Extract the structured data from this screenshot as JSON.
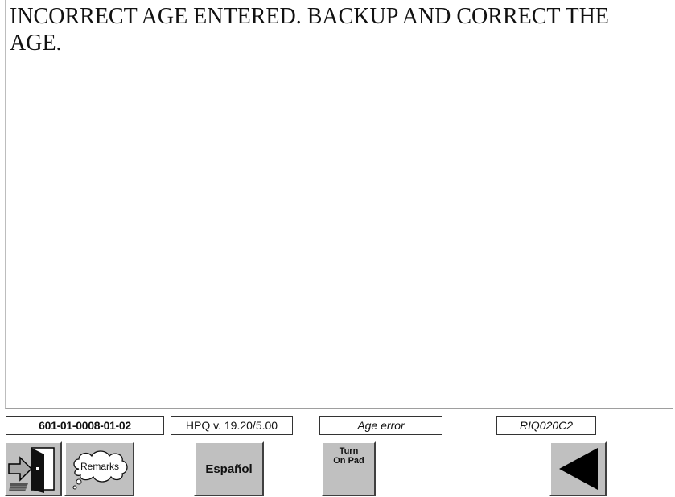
{
  "question": {
    "text": "INCORRECT AGE ENTERED. BACKUP AND CORRECT THE AGE."
  },
  "status_bar": {
    "case_id": "601-01-0008-01-02",
    "version": "HPQ v. 19.20/5.00",
    "error_label": "Age error",
    "screen_code": "RIQ020C2"
  },
  "buttons": {
    "exit_icon": "exit-door-icon",
    "remarks_label": "Remarks",
    "espanol_label": "Español",
    "pad_line1": "Turn",
    "pad_line2": "On Pad",
    "back_icon": "back-arrow-icon"
  },
  "colors": {
    "button_face": "#c0c0c0",
    "text": "#111111"
  }
}
